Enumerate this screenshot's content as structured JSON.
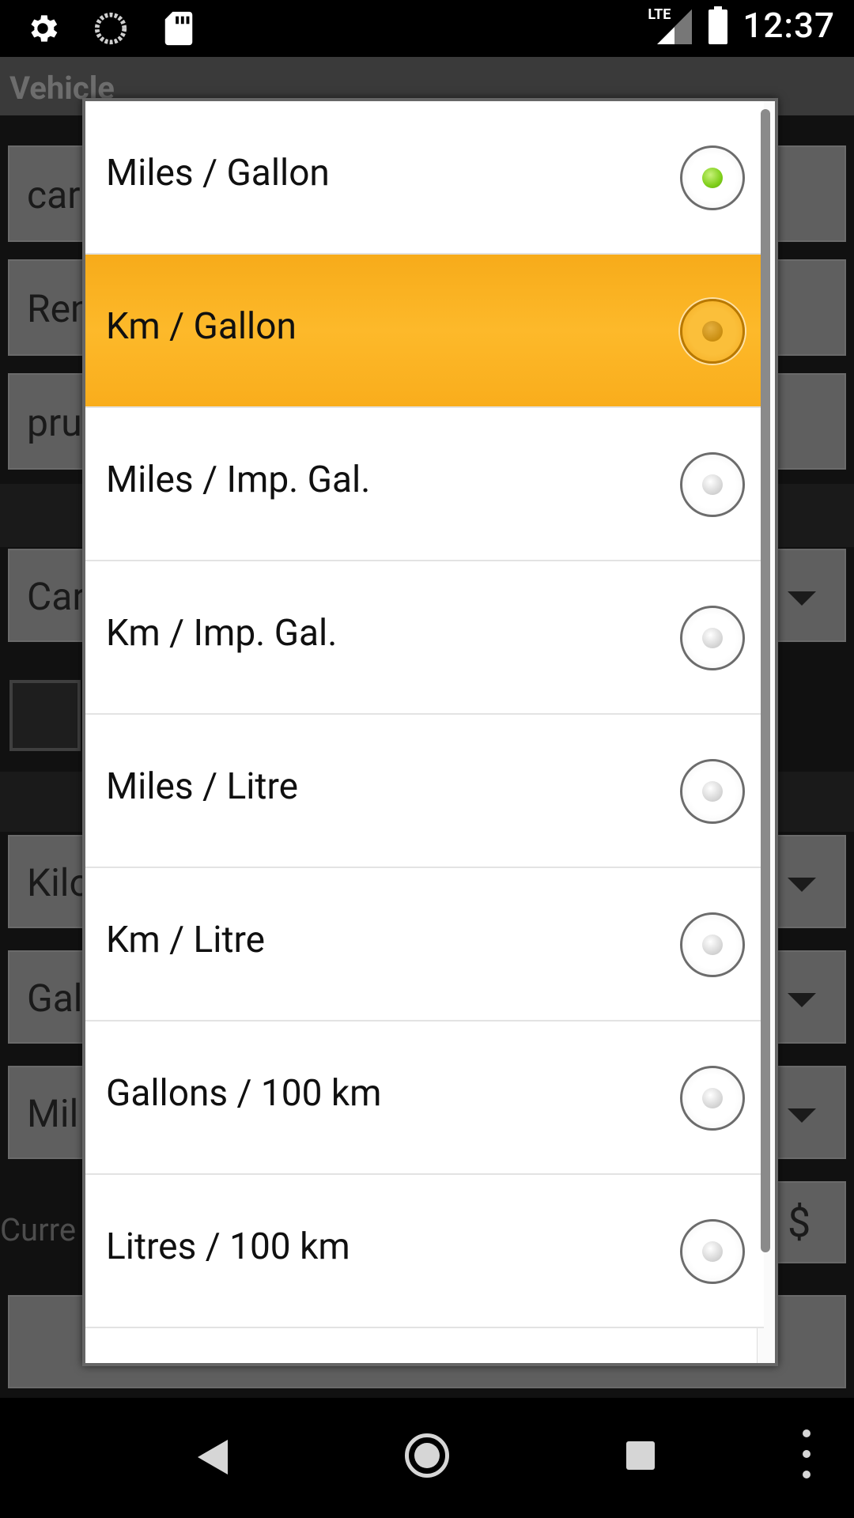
{
  "status_bar": {
    "time": "12:37",
    "network": "LTE",
    "left_icons": [
      "gear-icon",
      "sync-icon",
      "sd-card-icon"
    ],
    "right_icons": [
      "signal-icon",
      "battery-icon"
    ]
  },
  "background_app": {
    "title": "Vehicle",
    "fields": [
      {
        "text": "car"
      },
      {
        "text": "Ren"
      },
      {
        "text": "pru"
      },
      {
        "text": "Car"
      },
      {
        "text": "Kilo"
      },
      {
        "text": "Gal"
      },
      {
        "text": "Mil"
      }
    ],
    "currency_label": "Curre",
    "currency_symbol": "$"
  },
  "dialog": {
    "options": [
      {
        "label": "Miles / Gallon",
        "selected": true
      },
      {
        "label": "Km / Gallon",
        "selected": false,
        "pressed": true
      },
      {
        "label": "Miles / Imp. Gal.",
        "selected": false
      },
      {
        "label": "Km / Imp. Gal.",
        "selected": false
      },
      {
        "label": "Miles / Litre",
        "selected": false
      },
      {
        "label": "Km / Litre",
        "selected": false
      },
      {
        "label": "Gallons / 100 km",
        "selected": false
      },
      {
        "label": "Litres / 100 km",
        "selected": false
      }
    ]
  },
  "colors": {
    "pressed_highlight": "#fdb92a",
    "selected_radio": "#7fcf1a",
    "dialog_background": "#ffffff"
  },
  "nav_bar": {
    "buttons": [
      "back-icon",
      "home-icon",
      "recents-icon",
      "overflow-menu-icon"
    ]
  }
}
